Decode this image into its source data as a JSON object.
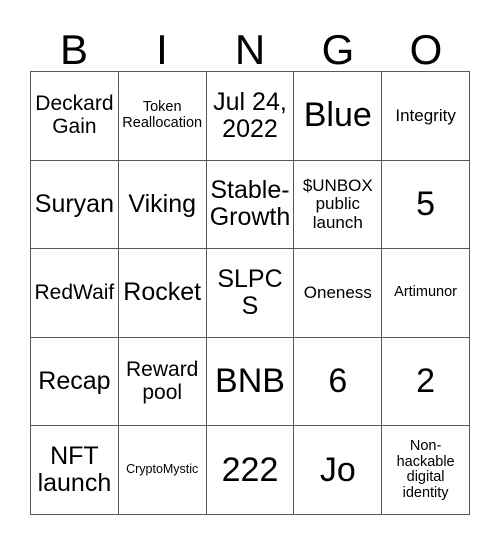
{
  "card": {
    "title": "BINGO card",
    "header": {
      "letters": [
        "B",
        "I",
        "N",
        "G",
        "O"
      ]
    },
    "grid": {
      "columns": 5,
      "rows": 5,
      "border_color": "#58585a",
      "background_color": "#ffffff",
      "text_color": "#000000",
      "cells": [
        {
          "text": "Deckard Gain",
          "size": "fs-m"
        },
        {
          "text": "Token Reallocation",
          "size": "fs-xs"
        },
        {
          "text": "Jul 24, 2022",
          "size": "fs-l"
        },
        {
          "text": "Blue",
          "size": "fs-xxl"
        },
        {
          "text": "Integrity",
          "size": "fs-s"
        },
        {
          "text": "Suryan",
          "size": "fs-l"
        },
        {
          "text": "Viking",
          "size": "fs-l"
        },
        {
          "text": "Stable-Growth",
          "size": "fs-l"
        },
        {
          "text": "$UNBOX public launch",
          "size": "fs-s"
        },
        {
          "text": "5",
          "size": "fs-xxl"
        },
        {
          "text": "RedWaif",
          "size": "fs-m"
        },
        {
          "text": "Rocket",
          "size": "fs-l"
        },
        {
          "text": "SLPCS",
          "size": "fs-l"
        },
        {
          "text": "Oneness",
          "size": "fs-s"
        },
        {
          "text": "Artimunor",
          "size": "fs-xs"
        },
        {
          "text": "Recap",
          "size": "fs-l"
        },
        {
          "text": "Reward pool",
          "size": "fs-m"
        },
        {
          "text": "BNB",
          "size": "fs-xxl"
        },
        {
          "text": "6",
          "size": "fs-xxl"
        },
        {
          "text": "2",
          "size": "fs-xxl"
        },
        {
          "text": "NFT launch",
          "size": "fs-l"
        },
        {
          "text": "CryptoMystic",
          "size": "fs-xxs"
        },
        {
          "text": "222",
          "size": "fs-xxl"
        },
        {
          "text": "Jo",
          "size": "fs-xxl"
        },
        {
          "text": "Non-hackable digital identity",
          "size": "fs-xs"
        }
      ]
    }
  }
}
